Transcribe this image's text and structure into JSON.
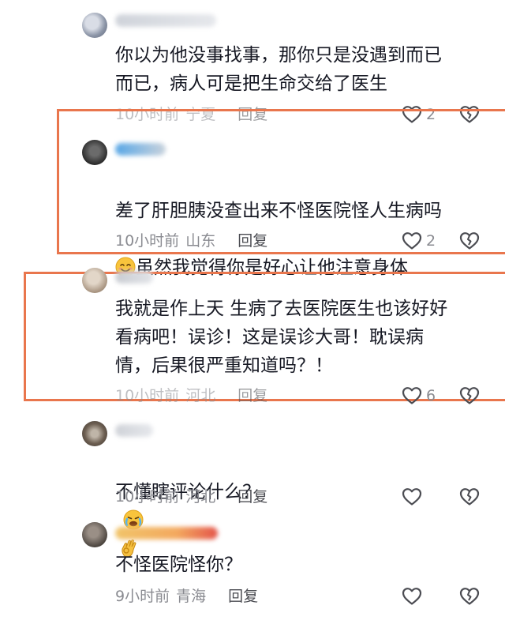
{
  "comments": [
    {
      "text": "你以为他没事找事，那你只是没遇到而已\n而已，病人可是把生命交给了医生",
      "time": "10小时前",
      "location": "宁夏",
      "reply_label": "回复",
      "likes": "2"
    },
    {
      "text_line1": "差了肝胆胰没查出来不怪医院怪人生病吗",
      "text_line2": "虽然我觉得你是好心让他注意身体",
      "time": "10小时前",
      "location": "山东",
      "reply_label": "回复",
      "likes": "2"
    },
    {
      "text": "我就是作上天 生病了去医院医生也该好好\n看病吧！误诊！这是误诊大哥！耽误病\n情，后果很严重知道吗？！",
      "time": "10小时前",
      "location": "河北",
      "reply_label": "回复",
      "likes": "6"
    },
    {
      "text": "不懂瞎评论什么？",
      "time": "10小时前",
      "location": "河北",
      "reply_label": "回复",
      "likes": ""
    },
    {
      "text": "不怪医院怪你？",
      "time": "9小时前",
      "location": "青海",
      "reply_label": "回复",
      "likes": ""
    }
  ],
  "colors": {
    "highlight_border": "#e9764d",
    "text": "#161823",
    "meta": "#8a8b91"
  }
}
